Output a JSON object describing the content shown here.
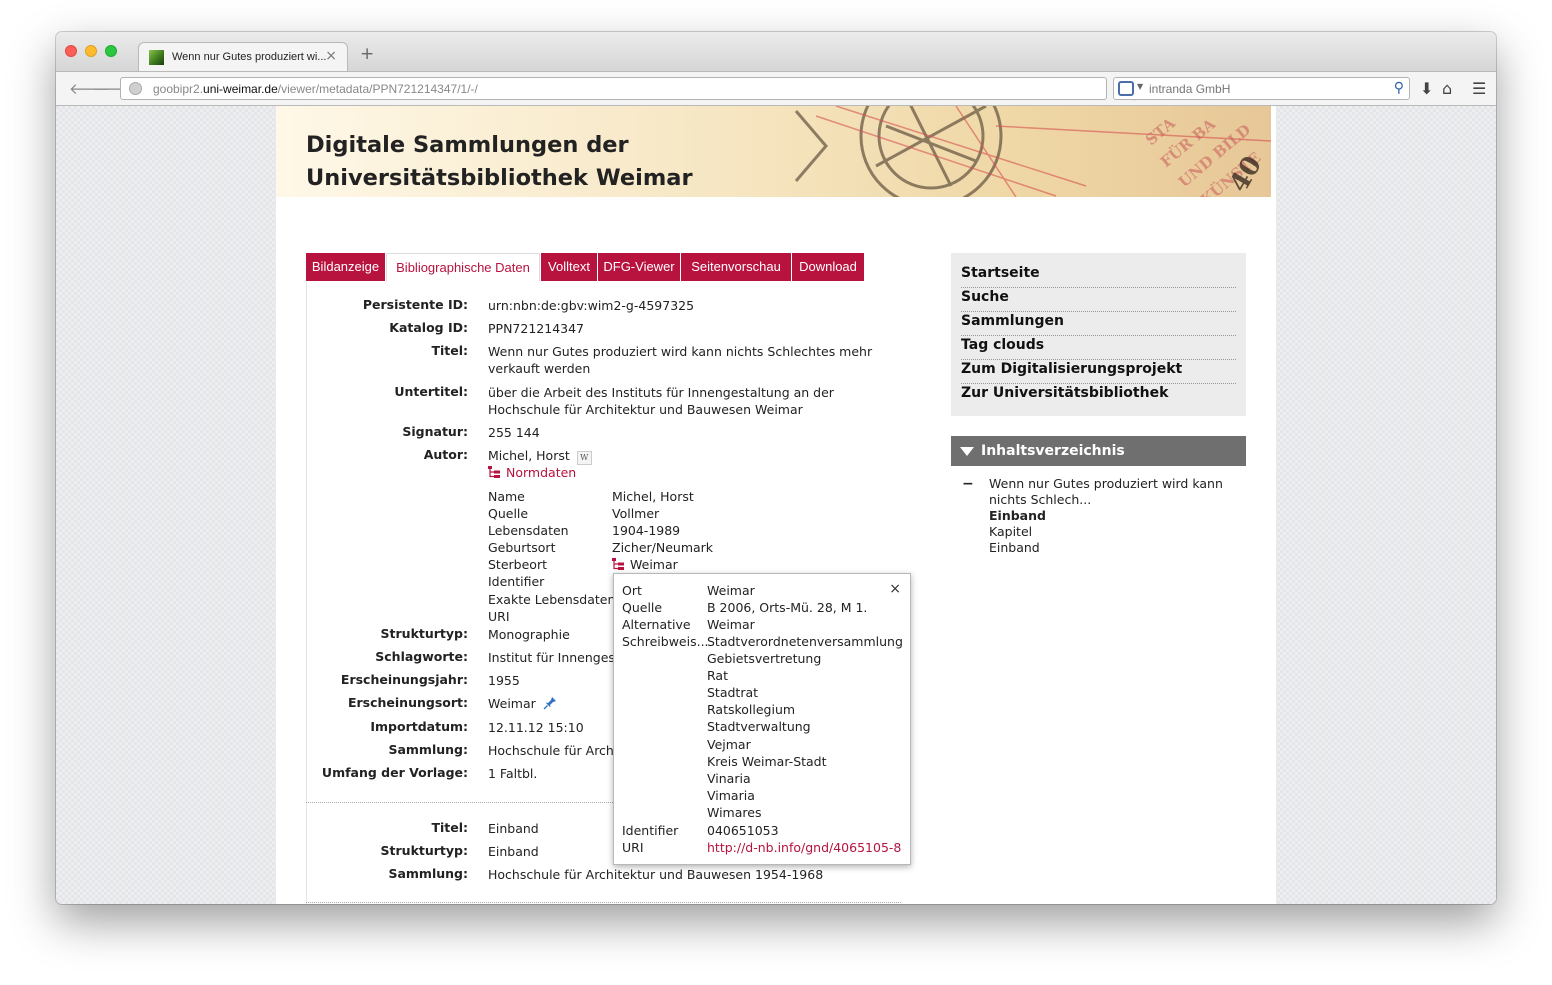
{
  "browser": {
    "tab_title": "Wenn nur Gutes produziert wi...",
    "tab_close": "×",
    "new_tab": "+",
    "url_host_prefix": "goobipr2.",
    "url_host": "uni-weimar.de",
    "url_path": "/viewer/metadata/PPN721214347/1/-/",
    "search_text": "intranda GmbH"
  },
  "header": {
    "title_line1": "Digitale Sammlungen der",
    "title_line2": "Universitätsbibliothek Weimar"
  },
  "tabs": [
    {
      "label": "Bildanzeige",
      "active": false
    },
    {
      "label": "Bibliographische Daten",
      "active": true
    },
    {
      "label": "Volltext",
      "active": false
    },
    {
      "label": "DFG-Viewer",
      "active": false
    },
    {
      "label": "Seitenvorschau",
      "active": false
    },
    {
      "label": "Download",
      "active": false
    }
  ],
  "metadata": {
    "persistente_id_label": "Persistente ID:",
    "persistente_id": "urn:nbn:de:gbv:wim2-g-4597325",
    "katalog_id_label": "Katalog ID:",
    "katalog_id": "PPN721214347",
    "titel_label": "Titel:",
    "titel": "Wenn nur Gutes produziert wird kann nichts Schlechtes mehr verkauft werden",
    "untertitel_label": "Untertitel:",
    "untertitel": "über die Arbeit des Instituts für Innengestaltung an der Hochschule für Architektur und Bauwesen Weimar",
    "signatur_label": "Signatur:",
    "signatur": "255 144",
    "autor_label": "Autor:",
    "autor": "Michel, Horst",
    "wiki_badge": "W",
    "normdaten_link": "Normdaten",
    "normdaten_rows": [
      {
        "key": "Name",
        "value": "Michel, Horst"
      },
      {
        "key": "Quelle",
        "value": "Vollmer"
      },
      {
        "key": "Lebensdaten",
        "value": "1904-1989"
      },
      {
        "key": "Geburtsort",
        "value": "Zicher/Neumark"
      },
      {
        "key": "Sterbeort",
        "value": "Weimar"
      },
      {
        "key": "Identifier",
        "value": ""
      },
      {
        "key": "Exakte Lebensdaten",
        "value": ""
      },
      {
        "key": "URI",
        "value": ""
      }
    ],
    "strukturtyp_label": "Strukturtyp:",
    "strukturtyp": "Monographie",
    "schlagworte_label": "Schlagworte:",
    "schlagworte": "Institut für Innenges",
    "erscheinungsjahr_label": "Erscheinungsjahr:",
    "erscheinungsjahr": "1955",
    "erscheinungsort_label": "Erscheinungsort:",
    "erscheinungsort": "Weimar",
    "importdatum_label": "Importdatum:",
    "importdatum": "12.11.12 15:10",
    "sammlung_label": "Sammlung:",
    "sammlung": "Hochschule für Archi",
    "umfang_label": "Umfang der Vorlage:",
    "umfang": "1 Faltbl."
  },
  "metadata2": {
    "titel_label": "Titel:",
    "titel": "Einband",
    "strukturtyp_label": "Strukturtyp:",
    "strukturtyp": "Einband",
    "sammlung_label": "Sammlung:",
    "sammlung": "Hochschule für Architektur und Bauwesen 1954-1968"
  },
  "popover": {
    "close": "×",
    "ort_label": "Ort",
    "ort": "Weimar",
    "quelle_label": "Quelle",
    "quelle": "B 2006, Orts-Mü. 28, M 1.",
    "alternative_label": "Alternative",
    "schreibweise_label": "Schreibweis...",
    "alternatives": [
      "Weimar",
      "Stadtverordnetenversammlung",
      "Gebietsvertretung",
      "Rat",
      "Stadtrat",
      "Ratskollegium",
      "Stadtverwaltung",
      "Vejmar",
      "Kreis Weimar-Stadt",
      "Vinaria",
      "Vimaria",
      "Wimares"
    ],
    "identifier_label": "Identifier",
    "identifier": "040651053",
    "uri_label": "URI",
    "uri": "http://d-nb.info/gnd/4065105-8"
  },
  "sidebar": {
    "nav": [
      "Startseite",
      "Suche",
      "Sammlungen",
      "Tag clouds",
      "Zum Digitalisierungsprojekt",
      "Zur Universitätsbibliothek"
    ],
    "toc_title": "Inhaltsverzeichnis",
    "toc_collapse": "−",
    "toc_root": "Wenn nur Gutes produziert wird kann nichts Schlech...",
    "toc_items": [
      {
        "label": "Einband",
        "current": true
      },
      {
        "label": "Kapitel",
        "current": false
      },
      {
        "label": "Einband",
        "current": false
      }
    ]
  },
  "colors": {
    "accent": "#b8123f",
    "sidebar_bg": "#ececec",
    "toc_header_bg": "#6f6f6f"
  }
}
